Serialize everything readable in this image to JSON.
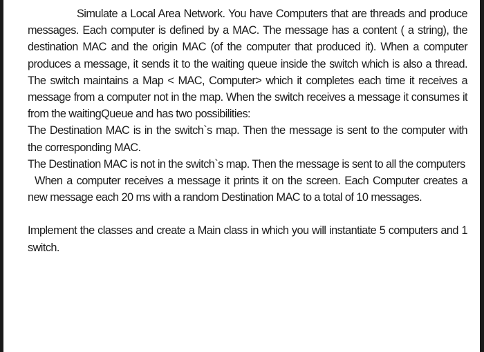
{
  "document": {
    "paragraphs": [
      "Simulate a Local Area Network. You have Computers that are threads and produce messages. Each computer is defined by a MAC. The message has a content ( a string), the destination MAC and the origin MAC (of the computer that produced it). When a computer produces a message, it sends it to the waiting queue inside the switch which is also a thread. The switch maintains a Map < MAC, Computer> which it completes each time it receives a message from a computer not in the map. When the switch receives a message it consumes it from the waitingQueue and has two possibilities:",
      "The Destination MAC is in the switch`s map. Then the message is sent to the computer with the corresponding MAC.",
      "The Destination MAC is not in the switch`s map. Then the message is sent to all the computers",
      "When a computer receives a message it prints it on the screen. Each Computer creates a new message each 20 ms with a random Destination MAC to a total of 10 messages.",
      "Implement the classes and create a Main class in which you will instantiate 5 computers and 1 switch."
    ]
  }
}
